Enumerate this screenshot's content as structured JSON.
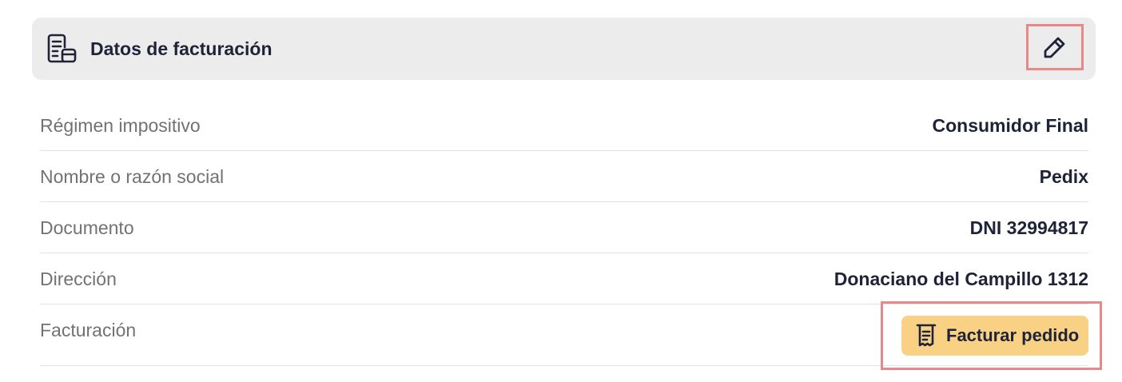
{
  "header": {
    "title": "Datos de facturación",
    "icon": "invoice-card-icon",
    "edit_icon": "pencil-icon"
  },
  "rows": [
    {
      "label": "Régimen impositivo",
      "value": "Consumidor Final"
    },
    {
      "label": "Nombre o razón social",
      "value": "Pedix"
    },
    {
      "label": "Documento",
      "value": "DNI 32994817"
    },
    {
      "label": "Dirección",
      "value": "Donaciano del Campillo 1312"
    }
  ],
  "billing": {
    "label": "Facturación",
    "button_label": "Facturar pedido",
    "button_icon": "receipt-icon",
    "button_color": "#f8d184"
  },
  "colors": {
    "header_bg": "#ececec",
    "text_dark": "#1f2337",
    "text_muted": "#727272",
    "highlight": "#e88888"
  }
}
